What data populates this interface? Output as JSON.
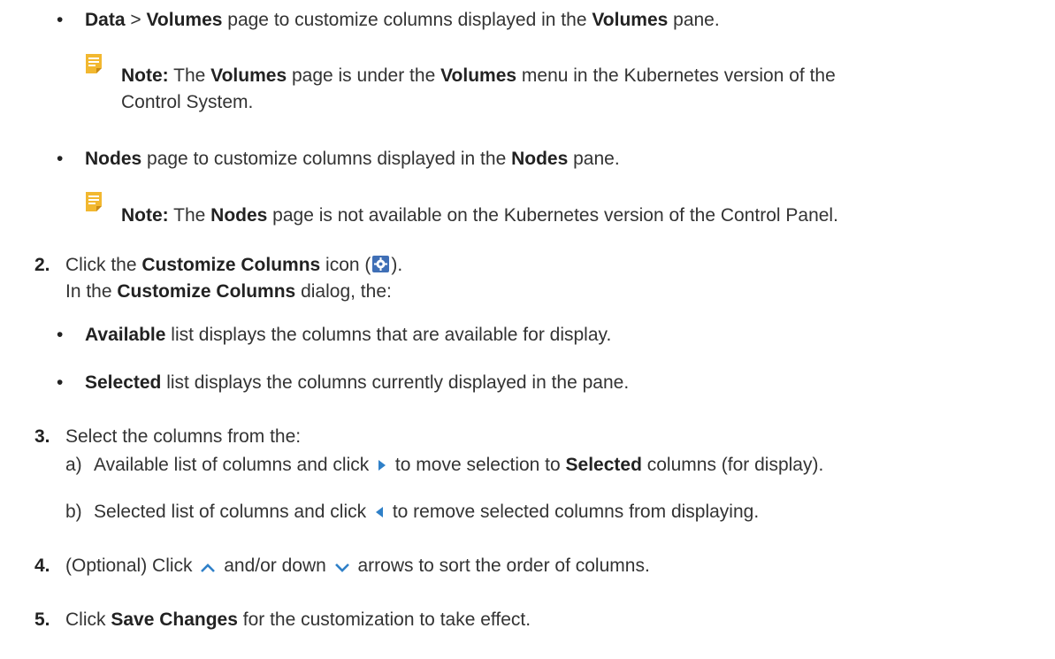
{
  "bullet1": {
    "b_data": "Data",
    "sep": " > ",
    "b_volumes": "Volumes",
    "text1": " page to customize columns displayed in the ",
    "b_volumes2": "Volumes",
    "text2": " pane."
  },
  "note1": {
    "label": "Note:",
    "t1": " The ",
    "b1": "Volumes",
    "t2": " page is under the ",
    "b2": "Volumes",
    "t3": " menu in the Kubernetes version of the",
    "line2": "Control System."
  },
  "bullet2": {
    "b_nodes": "Nodes",
    "text1": " page to customize columns displayed in the ",
    "b_nodes2": "Nodes",
    "text2": " pane."
  },
  "note2": {
    "label": "Note:",
    "t1": " The ",
    "b1": "Nodes",
    "t2": " page is not available on the Kubernetes version of the Control Panel."
  },
  "step2": {
    "num": "2.",
    "t1": "Click the ",
    "b1": "Customize Columns",
    "t2": " icon (",
    "t3": ").",
    "line2_t1": "In the ",
    "line2_b1": "Customize Columns",
    "line2_t2": " dialog, the:",
    "bullet_a_b": "Available",
    "bullet_a_t": " list displays the columns that are available for display.",
    "bullet_b_b": "Selected",
    "bullet_b_t": " list displays the columns currently displayed in the pane."
  },
  "step3": {
    "num": "3.",
    "text": "Select the columns from the:",
    "a_label": "a)",
    "a_t1": "Available list of columns and click ",
    "a_t2": " to move selection to ",
    "a_b": "Selected",
    "a_t3": " columns (for display).",
    "b_label": "b)",
    "b_t1": "Selected list of columns and click ",
    "b_t2": " to remove selected columns from displaying."
  },
  "step4": {
    "num": "4.",
    "t1": "(Optional) Click ",
    "t2": " and/or down ",
    "t3": " arrows to sort the order of columns."
  },
  "step5": {
    "num": "5.",
    "t1": "Click ",
    "b1": "Save Changes",
    "t2": " for the customization to take effect."
  },
  "colors": {
    "note_icon": "#f2b830",
    "gear_icon_bg": "#3f6fb6",
    "arrow_icon": "#2f80c8"
  }
}
